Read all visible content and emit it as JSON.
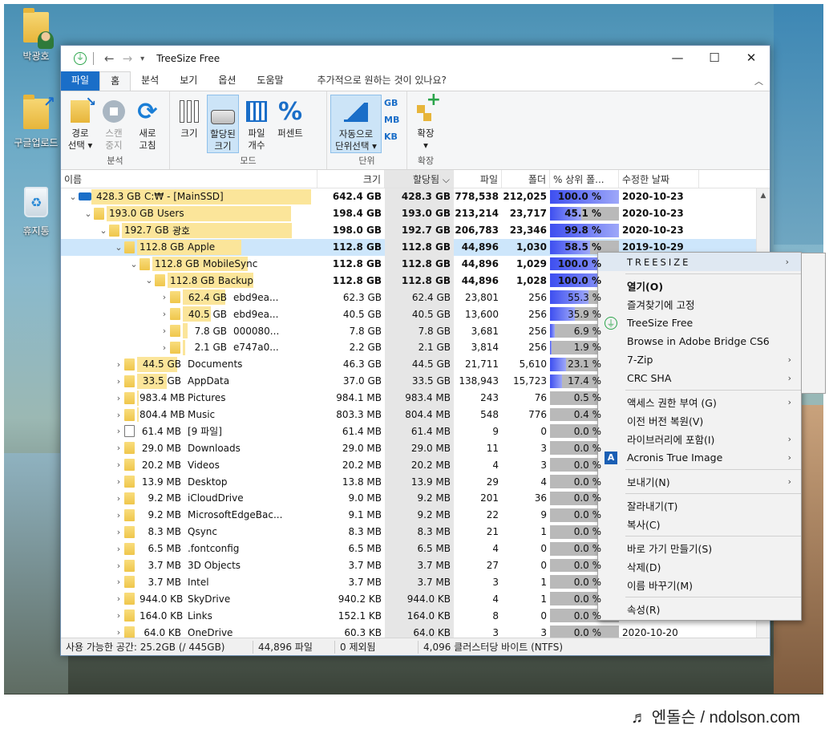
{
  "desktop": {
    "icons": [
      {
        "label": "박광호",
        "kind": "user-folder"
      },
      {
        "label": "구글업로드",
        "kind": "shortcut-folder"
      },
      {
        "label": "휴지통",
        "kind": "recycle-bin"
      }
    ]
  },
  "window": {
    "title": "TreeSize Free",
    "tabs": [
      {
        "label": "파일",
        "state": "file"
      },
      {
        "label": "홈",
        "state": "active"
      },
      {
        "label": "분석",
        "state": ""
      },
      {
        "label": "보기",
        "state": ""
      },
      {
        "label": "옵션",
        "state": ""
      },
      {
        "label": "도움말",
        "state": ""
      }
    ],
    "help_prompt": "추가적으로 원하는 것이 있나요?"
  },
  "ribbon": {
    "analysis": {
      "label": "분석",
      "buttons": [
        {
          "line1": "경로",
          "line2": "선택 ▾",
          "icon": "folder-arrow-icon"
        },
        {
          "line1": "스캔",
          "line2": "중지",
          "icon": "stop-icon"
        },
        {
          "line1": "새로",
          "line2": "고침",
          "icon": "refresh-icon"
        }
      ]
    },
    "mode": {
      "label": "모드",
      "buttons": [
        {
          "line1": "크기",
          "line2": "",
          "icon": "bars-icon",
          "selected": false
        },
        {
          "line1": "할당된",
          "line2": "크기",
          "icon": "hdd-icon",
          "selected": true
        },
        {
          "line1": "파일",
          "line2": "개수",
          "icon": "grid-icon",
          "selected": false
        },
        {
          "line1": "퍼센트",
          "line2": "",
          "icon": "percent-icon",
          "selected": false
        }
      ]
    },
    "unit": {
      "label": "단위",
      "auto_line1": "자동으로",
      "auto_line2": "단위선택 ▾",
      "units": [
        "GB",
        "MB",
        "KB"
      ]
    },
    "expand": {
      "label": "확장",
      "button_line1": "확장",
      "button_line2": "▾"
    }
  },
  "columns": {
    "name": "이름",
    "size": "크기",
    "allocated": "할당됨 ⌵",
    "files": "파일",
    "folders": "폴더",
    "pct": "% 상위 폴...",
    "date": "수정한 날짜"
  },
  "rows": [
    {
      "level": 0,
      "chev": "⌄",
      "kind": "drive",
      "nsize": "428.3 GB",
      "name": "C:₩ - [MainSSD]",
      "size": "642.4 GB",
      "alloc": "428.3 GB",
      "files": "778,538",
      "folders": "212,025",
      "pct": "100.0 %",
      "pct_value": 100,
      "date": "2020-10-23",
      "bar": 1.0,
      "bold": true
    },
    {
      "level": 1,
      "chev": "⌄",
      "kind": "folder",
      "nsize": "193.0 GB",
      "name": "Users",
      "size": "198.4 GB",
      "alloc": "193.0 GB",
      "files": "213,214",
      "folders": "23,717",
      "pct": "45.1 %",
      "pct_value": 45.1,
      "date": "2020-10-23",
      "bar": 0.9,
      "bold": true
    },
    {
      "level": 2,
      "chev": "⌄",
      "kind": "folder",
      "nsize": "192.7 GB",
      "name": "광호",
      "size": "198.0 GB",
      "alloc": "192.7 GB",
      "files": "206,783",
      "folders": "23,346",
      "pct": "99.8 %",
      "pct_value": 99.8,
      "date": "2020-10-23",
      "bar": 0.9,
      "bold": true
    },
    {
      "level": 3,
      "chev": "⌄",
      "kind": "folder",
      "nsize": "112.8 GB",
      "name": "Apple",
      "size": "112.8 GB",
      "alloc": "112.8 GB",
      "files": "44,896",
      "folders": "1,030",
      "pct": "58.5 %",
      "pct_value": 58.5,
      "date": "2019-10-29",
      "bar": 0.6,
      "bold": true,
      "selected": true
    },
    {
      "level": 4,
      "chev": "⌄",
      "kind": "folder",
      "nsize": "112.8 GB",
      "name": "MobileSync",
      "size": "112.8 GB",
      "alloc": "112.8 GB",
      "files": "44,896",
      "folders": "1,029",
      "pct": "100.0 %",
      "pct_value": 100,
      "date": "",
      "bar": 0.6,
      "bold": true
    },
    {
      "level": 5,
      "chev": "⌄",
      "kind": "folder",
      "nsize": "112.8 GB",
      "name": "Backup",
      "size": "112.8 GB",
      "alloc": "112.8 GB",
      "files": "44,896",
      "folders": "1,028",
      "pct": "100.0 %",
      "pct_value": 100,
      "date": "",
      "bar": 0.6,
      "bold": true
    },
    {
      "level": 6,
      "chev": "›",
      "kind": "folder",
      "nsize": "62.4 GB",
      "name": "ebd9ea...",
      "size": "62.3 GB",
      "alloc": "62.4 GB",
      "files": "23,801",
      "folders": "256",
      "pct": "55.3 %",
      "pct_value": 55.3,
      "date": "",
      "bar": 0.33
    },
    {
      "level": 6,
      "chev": "›",
      "kind": "folder",
      "nsize": "40.5 GB",
      "name": "ebd9ea...",
      "size": "40.5 GB",
      "alloc": "40.5 GB",
      "files": "13,600",
      "folders": "256",
      "pct": "35.9 %",
      "pct_value": 35.9,
      "date": "",
      "bar": 0.22
    },
    {
      "level": 6,
      "chev": "›",
      "kind": "folder",
      "nsize": "7.8 GB",
      "name": "000080...",
      "size": "7.8 GB",
      "alloc": "7.8 GB",
      "files": "3,681",
      "folders": "256",
      "pct": "6.9 %",
      "pct_value": 6.9,
      "date": "",
      "bar": 0.04
    },
    {
      "level": 6,
      "chev": "›",
      "kind": "folder",
      "nsize": "2.1 GB",
      "name": "e747a0...",
      "size": "2.2 GB",
      "alloc": "2.1 GB",
      "files": "3,814",
      "folders": "256",
      "pct": "1.9 %",
      "pct_value": 1.9,
      "date": "",
      "bar": 0.02
    },
    {
      "level": 3,
      "chev": "›",
      "kind": "folder",
      "nsize": "44.5 GB",
      "name": "Documents",
      "size": "46.3 GB",
      "alloc": "44.5 GB",
      "files": "21,711",
      "folders": "5,610",
      "pct": "23.1 %",
      "pct_value": 23.1,
      "date": "",
      "bar": 0.23
    },
    {
      "level": 3,
      "chev": "›",
      "kind": "folder",
      "nsize": "33.5 GB",
      "name": "AppData",
      "size": "37.0 GB",
      "alloc": "33.5 GB",
      "files": "138,943",
      "folders": "15,723",
      "pct": "17.4 %",
      "pct_value": 17.4,
      "date": "",
      "bar": 0.17
    },
    {
      "level": 3,
      "chev": "›",
      "kind": "folder",
      "nsize": "983.4 MB",
      "name": "Pictures",
      "size": "984.1 MB",
      "alloc": "983.4 MB",
      "files": "243",
      "folders": "76",
      "pct": "0.5 %",
      "pct_value": 0.5,
      "date": "",
      "bar": 0.01
    },
    {
      "level": 3,
      "chev": "›",
      "kind": "folder",
      "nsize": "804.4 MB",
      "name": "Music",
      "size": "803.3 MB",
      "alloc": "804.4 MB",
      "files": "548",
      "folders": "776",
      "pct": "0.4 %",
      "pct_value": 0.4,
      "date": "",
      "bar": 0.01
    },
    {
      "level": 3,
      "chev": "›",
      "kind": "file",
      "nsize": "61.4 MB",
      "name": "[9 파일]",
      "size": "61.4 MB",
      "alloc": "61.4 MB",
      "files": "9",
      "folders": "0",
      "pct": "0.0 %",
      "pct_value": 0,
      "date": "",
      "bar": 0
    },
    {
      "level": 3,
      "chev": "›",
      "kind": "folder",
      "nsize": "29.0 MB",
      "name": "Downloads",
      "size": "29.0 MB",
      "alloc": "29.0 MB",
      "files": "11",
      "folders": "3",
      "pct": "0.0 %",
      "pct_value": 0,
      "date": "",
      "bar": 0
    },
    {
      "level": 3,
      "chev": "›",
      "kind": "folder",
      "nsize": "20.2 MB",
      "name": "Videos",
      "size": "20.2 MB",
      "alloc": "20.2 MB",
      "files": "4",
      "folders": "3",
      "pct": "0.0 %",
      "pct_value": 0,
      "date": "",
      "bar": 0
    },
    {
      "level": 3,
      "chev": "›",
      "kind": "folder",
      "nsize": "13.9 MB",
      "name": "Desktop",
      "size": "13.8 MB",
      "alloc": "13.9 MB",
      "files": "29",
      "folders": "4",
      "pct": "0.0 %",
      "pct_value": 0,
      "date": "",
      "bar": 0
    },
    {
      "level": 3,
      "chev": "›",
      "kind": "folder",
      "nsize": "9.2 MB",
      "name": "iCloudDrive",
      "size": "9.0 MB",
      "alloc": "9.2 MB",
      "files": "201",
      "folders": "36",
      "pct": "0.0 %",
      "pct_value": 0,
      "date": "",
      "bar": 0
    },
    {
      "level": 3,
      "chev": "›",
      "kind": "folder",
      "nsize": "9.2 MB",
      "name": "MicrosoftEdgeBac...",
      "size": "9.1 MB",
      "alloc": "9.2 MB",
      "files": "22",
      "folders": "9",
      "pct": "0.0 %",
      "pct_value": 0,
      "date": "",
      "bar": 0
    },
    {
      "level": 3,
      "chev": "›",
      "kind": "folder",
      "nsize": "8.3 MB",
      "name": "Qsync",
      "size": "8.3 MB",
      "alloc": "8.3 MB",
      "files": "21",
      "folders": "1",
      "pct": "0.0 %",
      "pct_value": 0,
      "date": "",
      "bar": 0
    },
    {
      "level": 3,
      "chev": "›",
      "kind": "folder",
      "nsize": "6.5 MB",
      "name": ".fontconfig",
      "size": "6.5 MB",
      "alloc": "6.5 MB",
      "files": "4",
      "folders": "0",
      "pct": "0.0 %",
      "pct_value": 0,
      "date": "",
      "bar": 0
    },
    {
      "level": 3,
      "chev": "›",
      "kind": "folder",
      "nsize": "3.7 MB",
      "name": "3D Objects",
      "size": "3.7 MB",
      "alloc": "3.7 MB",
      "files": "27",
      "folders": "0",
      "pct": "0.0 %",
      "pct_value": 0,
      "date": "",
      "bar": 0
    },
    {
      "level": 3,
      "chev": "›",
      "kind": "folder",
      "nsize": "3.7 MB",
      "name": "Intel",
      "size": "3.7 MB",
      "alloc": "3.7 MB",
      "files": "3",
      "folders": "1",
      "pct": "0.0 %",
      "pct_value": 0,
      "date": "",
      "bar": 0
    },
    {
      "level": 3,
      "chev": "›",
      "kind": "folder",
      "nsize": "944.0 KB",
      "name": "SkyDrive",
      "size": "940.2 KB",
      "alloc": "944.0 KB",
      "files": "4",
      "folders": "1",
      "pct": "0.0 %",
      "pct_value": 0,
      "date": "",
      "bar": 0
    },
    {
      "level": 3,
      "chev": "›",
      "kind": "folder",
      "nsize": "164.0 KB",
      "name": "Links",
      "size": "152.1 KB",
      "alloc": "164.0 KB",
      "files": "8",
      "folders": "0",
      "pct": "0.0 %",
      "pct_value": 0,
      "date": "",
      "bar": 0
    },
    {
      "level": 3,
      "chev": "›",
      "kind": "folder",
      "nsize": "64.0 KB",
      "name": "OneDrive",
      "size": "60.3 KB",
      "alloc": "64.0 KB",
      "files": "3",
      "folders": "3",
      "pct": "0.0 %",
      "pct_value": 0,
      "date": "2020-10-20",
      "bar": 0
    }
  ],
  "status": {
    "free_space": "사용 가능한 공간: 25.2GB  (/ 445GB)",
    "file_count": "44,896 파일",
    "excluded": "0 제외됨",
    "cluster": "4,096 클러스터당 바이트 (NTFS)"
  },
  "context_menu": {
    "items": [
      {
        "label": "TREESIZE",
        "type": "head",
        "sub": true,
        "icon": ""
      },
      {
        "type": "sep"
      },
      {
        "label": "열기(O)",
        "type": "bold",
        "sub": false,
        "icon": ""
      },
      {
        "label": "즐겨찾기에 고정",
        "type": "",
        "sub": false,
        "icon": ""
      },
      {
        "label": "TreeSize Free",
        "type": "",
        "sub": false,
        "icon": "treesize-icon"
      },
      {
        "label": "Browse in Adobe Bridge CS6",
        "type": "",
        "sub": false,
        "icon": ""
      },
      {
        "label": "7-Zip",
        "type": "",
        "sub": true,
        "icon": ""
      },
      {
        "label": "CRC SHA",
        "type": "",
        "sub": true,
        "icon": ""
      },
      {
        "type": "sep"
      },
      {
        "label": "액세스 권한 부여 (G)",
        "type": "",
        "sub": true,
        "icon": ""
      },
      {
        "label": "이전 버전 복원(V)",
        "type": "",
        "sub": false,
        "icon": ""
      },
      {
        "label": "라이브러리에 포함(I)",
        "type": "",
        "sub": true,
        "icon": ""
      },
      {
        "label": "Acronis True Image",
        "type": "",
        "sub": true,
        "icon": "acronis-icon"
      },
      {
        "type": "sep"
      },
      {
        "label": "보내기(N)",
        "type": "",
        "sub": true,
        "icon": ""
      },
      {
        "type": "sep"
      },
      {
        "label": "잘라내기(T)",
        "type": "",
        "sub": false,
        "icon": ""
      },
      {
        "label": "복사(C)",
        "type": "",
        "sub": false,
        "icon": ""
      },
      {
        "type": "sep"
      },
      {
        "label": "바로 가기 만들기(S)",
        "type": "",
        "sub": false,
        "icon": ""
      },
      {
        "label": "삭제(D)",
        "type": "",
        "sub": false,
        "icon": ""
      },
      {
        "label": "이름 바꾸기(M)",
        "type": "",
        "sub": false,
        "icon": ""
      },
      {
        "type": "sep"
      },
      {
        "label": "속성(R)",
        "type": "",
        "sub": false,
        "icon": ""
      }
    ]
  },
  "watermark": "♬ 엔돌슨 / ndolson.com"
}
